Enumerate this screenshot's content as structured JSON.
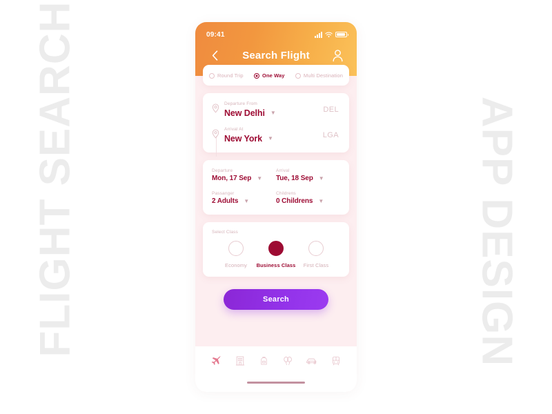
{
  "watermarks": {
    "left": "FLIGHT SEARCH",
    "right": "APP DESIGN"
  },
  "colors": {
    "header_gradient_from": "#ef8b3f",
    "header_gradient_to": "#fbc25a",
    "accent_maroon": "#9d0b33",
    "muted_pink": "#d9b0b8",
    "background_pink": "#fdeef0",
    "button_purple": "#9333ea"
  },
  "statusbar": {
    "time": "09:41",
    "signal_icon": "signal-bars-icon",
    "wifi_icon": "wifi-icon",
    "battery_icon": "battery-icon"
  },
  "header": {
    "back_icon": "back-chevron-icon",
    "title": "Search Flight",
    "profile_icon": "user-profile-icon"
  },
  "trip_types": [
    {
      "label": "Round Trip",
      "selected": false
    },
    {
      "label": "One Way",
      "selected": true
    },
    {
      "label": "Multi Destination",
      "selected": false
    }
  ],
  "route": {
    "departure": {
      "icon": "location-pin-icon",
      "label": "Departure From",
      "value": "New Delhi",
      "chevron": "chevron-down-icon",
      "code": "DEL"
    },
    "arrival": {
      "icon": "location-pin-icon",
      "label": "Arrival At",
      "value": "New York",
      "chevron": "chevron-down-icon",
      "code": "LGA"
    }
  },
  "dates": {
    "departure": {
      "label": "Departure",
      "value": "Mon, 17 Sep"
    },
    "arrival": {
      "label": "Arrival",
      "value": "Tue, 18 Sep"
    },
    "passenger": {
      "label": "Passanger",
      "value": "2 Adults"
    },
    "childrens": {
      "label": "Childrens",
      "value": "0 Childrens"
    }
  },
  "select_class": {
    "label": "Select Class",
    "options": [
      {
        "name": "Economy",
        "selected": false
      },
      {
        "name": "Business Class",
        "selected": true
      },
      {
        "name": "First Class",
        "selected": false
      }
    ]
  },
  "search_button": {
    "label": "Search"
  },
  "tabbar": {
    "items": [
      {
        "icon": "plane-icon",
        "active": true
      },
      {
        "icon": "hotel-icon",
        "active": false
      },
      {
        "icon": "backpack-icon",
        "active": false
      },
      {
        "icon": "balloons-icon",
        "active": false
      },
      {
        "icon": "taxi-icon",
        "active": false
      },
      {
        "icon": "train-icon",
        "active": false
      }
    ],
    "home_indicator": "home-indicator"
  }
}
